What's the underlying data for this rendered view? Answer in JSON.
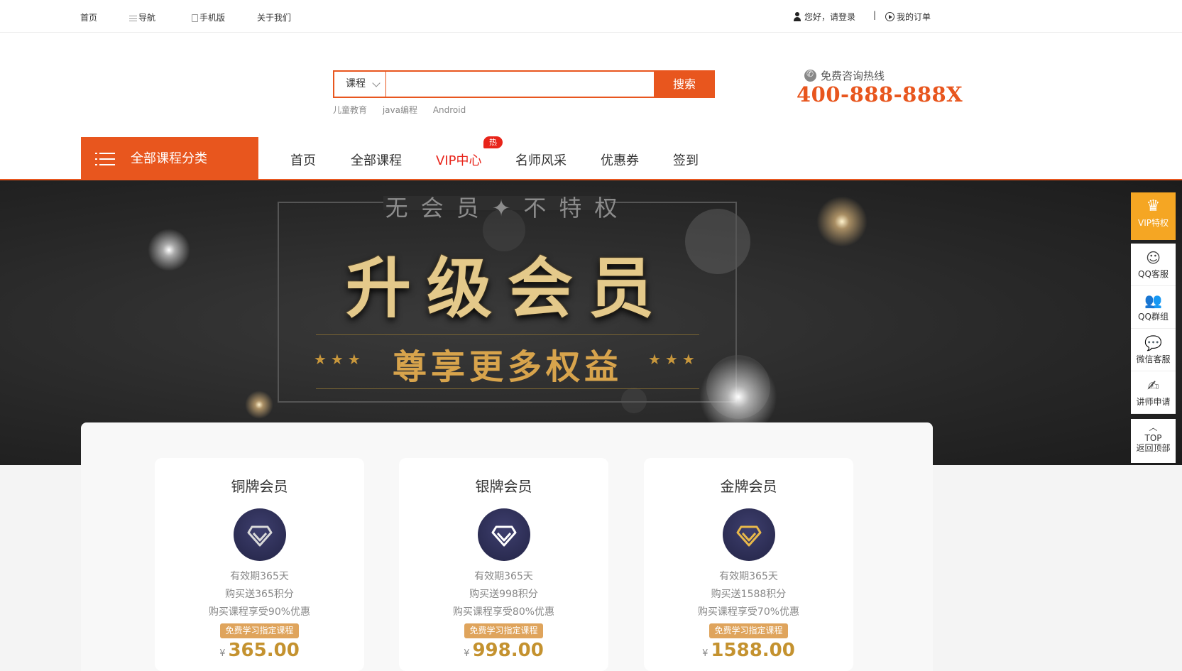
{
  "topbar": {
    "home": "首页",
    "nav": "导航",
    "mobile": "手机版",
    "about": "关于我们",
    "login": "您好，请登录",
    "separator": "|",
    "orders": "我的订单"
  },
  "search": {
    "category": "课程",
    "placeholder": "",
    "button": "搜索",
    "hot_words": [
      "儿童教育",
      "java编程",
      "Android"
    ]
  },
  "hotline": {
    "label": "免费咨询热线",
    "number": "400-888-888X"
  },
  "nav": {
    "all_categories": "全部课程分类",
    "items": [
      "首页",
      "全部课程",
      "VIP中心",
      "名师风采",
      "优惠券",
      "签到"
    ],
    "hot_badge": "热"
  },
  "banner": {
    "subtitle": "无会员✦不特权",
    "title": "升级会员",
    "slogan": "尊享更多权益",
    "stars": "★★★"
  },
  "side": {
    "vip": "VIP特权",
    "qq_service": "QQ客服",
    "qq_group": "QQ群组",
    "wechat": "微信客服",
    "teacher": "讲师申请",
    "top": "TOP",
    "back_top": "返回顶部"
  },
  "plans": [
    {
      "name": "铜牌会员",
      "period": "有效期365天",
      "points": "购买送365积分",
      "discount": "购买课程享受90%优惠",
      "free": "免费学习指定课程",
      "currency": "¥",
      "price": "365.00",
      "diamond_color": "#d9d9d9"
    },
    {
      "name": "银牌会员",
      "period": "有效期365天",
      "points": "购买送998积分",
      "discount": "购买课程享受80%优惠",
      "free": "免费学习指定课程",
      "currency": "¥",
      "price": "998.00",
      "diamond_color": "#ffffff"
    },
    {
      "name": "金牌会员",
      "period": "有效期365天",
      "points": "购买送1588积分",
      "discount": "购买课程享受70%优惠",
      "free": "免费学习指定课程",
      "currency": "¥",
      "price": "1588.00",
      "diamond_color": "#e8b84a"
    }
  ],
  "colors": {
    "accent": "#e8561e",
    "vip_red": "#e8241a",
    "gold": "#c4922f",
    "side_vip": "#f5a623"
  }
}
